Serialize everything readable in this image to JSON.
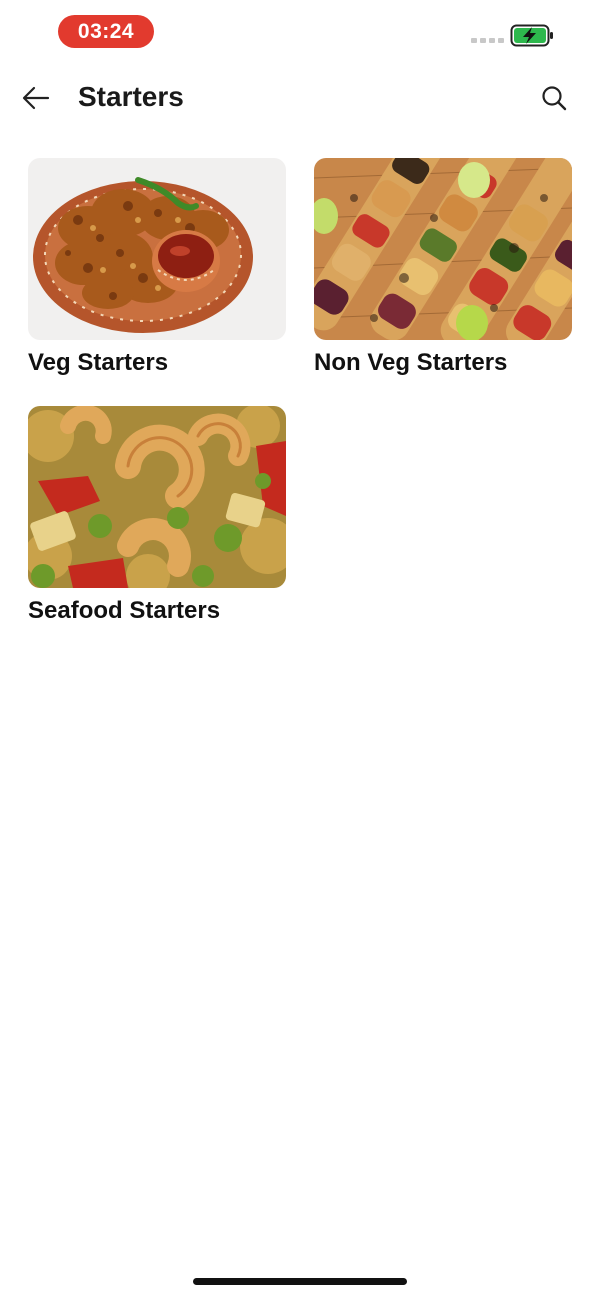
{
  "status_bar": {
    "time": "03:24",
    "time_pill_color": "#e23a2e",
    "battery_color": "#2db84d"
  },
  "header": {
    "title": "Starters",
    "back_icon": "arrow-left-icon",
    "search_icon": "search-icon"
  },
  "categories": [
    {
      "label": "Veg Starters",
      "image": "onion-pakoda-plate"
    },
    {
      "label": "Non Veg Starters",
      "image": "chicken-skewers"
    },
    {
      "label": "Seafood Starters",
      "image": "shrimp-curry"
    }
  ]
}
